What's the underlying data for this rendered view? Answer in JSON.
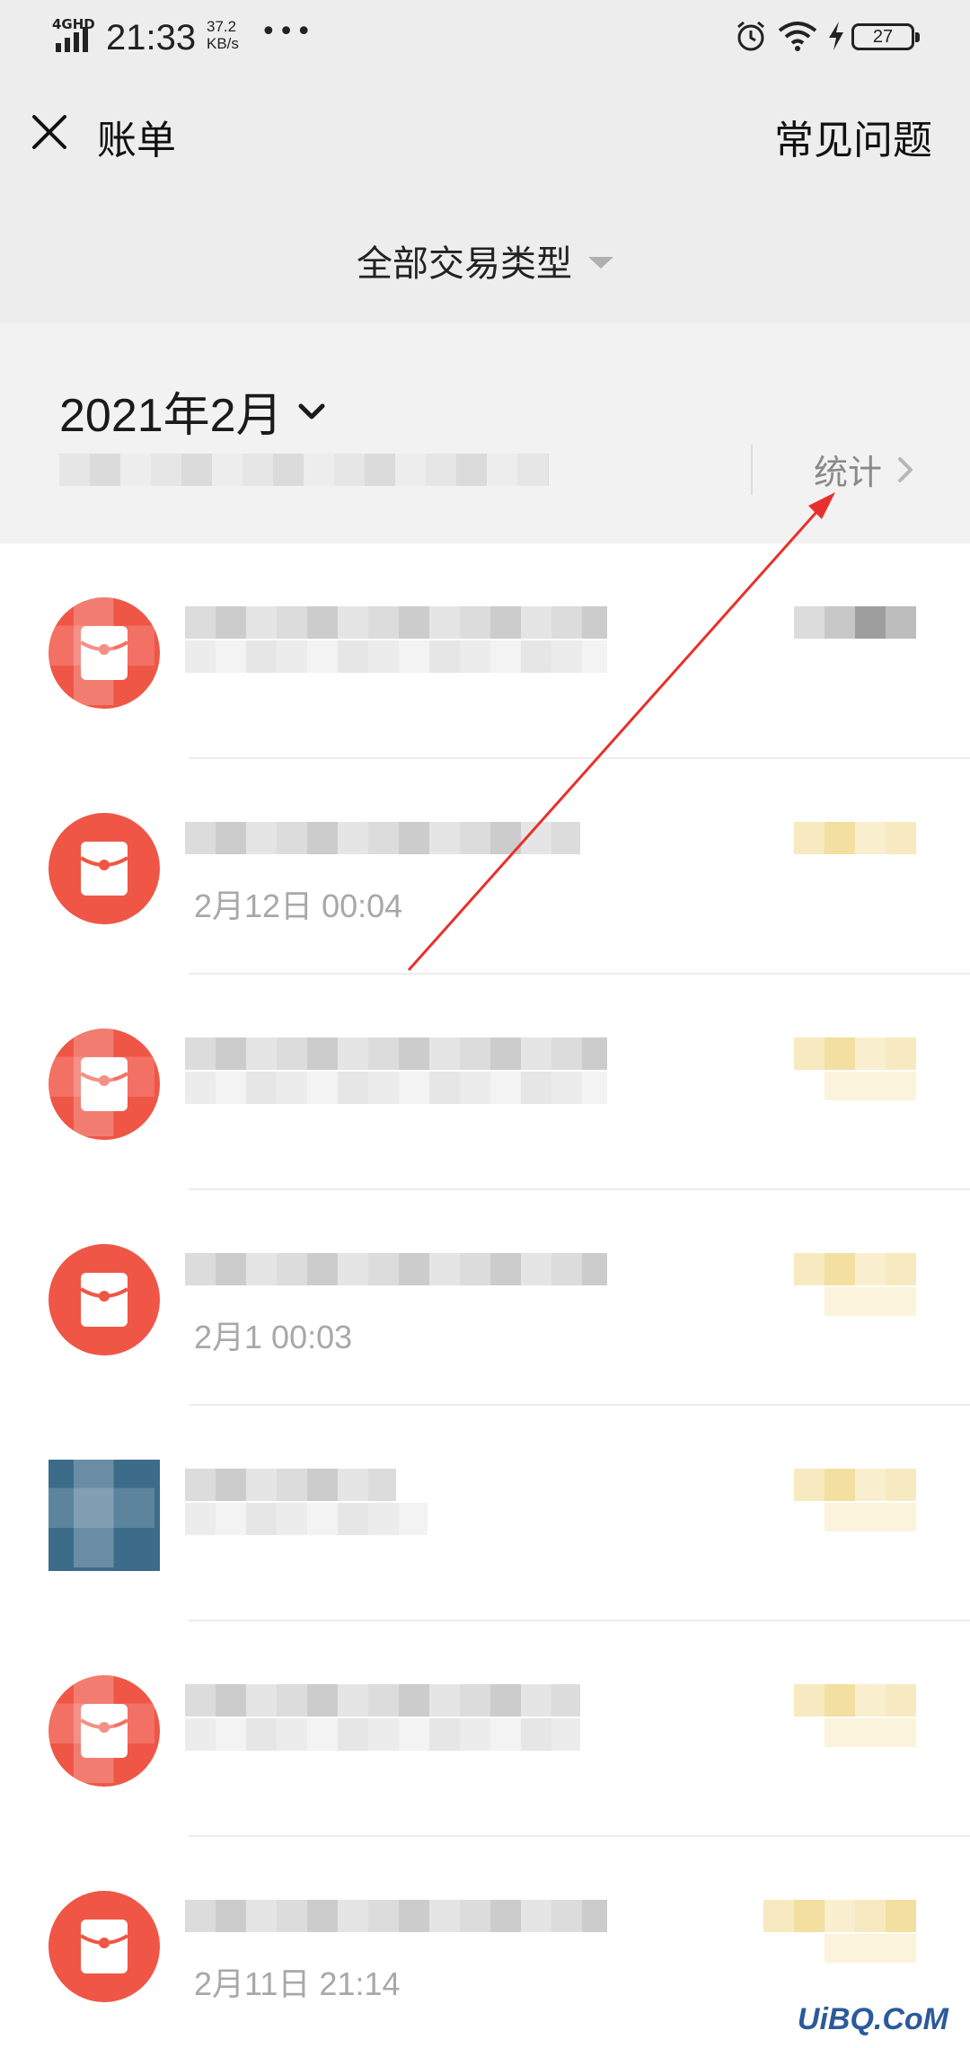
{
  "status_bar": {
    "network": "4GHD",
    "time": "21:33",
    "speed_value": "37.2",
    "speed_unit": "KB/s",
    "more": "•••",
    "battery": "27"
  },
  "nav": {
    "title": "账单",
    "faq": "常见问题"
  },
  "filter": {
    "label": "全部交易类型"
  },
  "month": {
    "label": "2021年2月",
    "stats_label": "统计"
  },
  "transactions": [
    {
      "icon": "red-envelope-icon",
      "title": "",
      "time": "",
      "amount": ""
    },
    {
      "icon": "red-envelope-icon",
      "title": "",
      "time": "2月12日 00:04",
      "amount": ""
    },
    {
      "icon": "red-envelope-icon",
      "title": "",
      "time": "",
      "amount": ""
    },
    {
      "icon": "red-envelope-icon",
      "title": "",
      "time": "2月1 00:03",
      "amount": ""
    },
    {
      "icon": "transfer-icon",
      "title": "",
      "time": "",
      "amount": ""
    },
    {
      "icon": "red-envelope-icon",
      "title": "",
      "time": "",
      "amount": ""
    },
    {
      "icon": "red-envelope-icon",
      "title": "",
      "time": "2月11日 21:14",
      "amount": ""
    }
  ],
  "watermark": "UiBQ.CoM",
  "colors": {
    "accent_red": "#ef5646",
    "background": "#ededed",
    "annotation_red": "#e8302a"
  }
}
